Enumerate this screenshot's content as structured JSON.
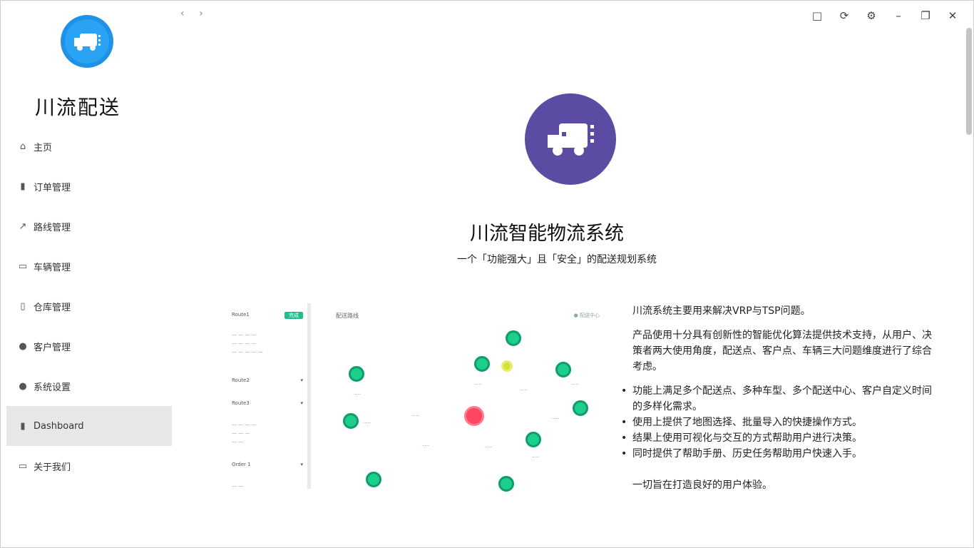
{
  "window": {
    "back": "‹",
    "forward": "›",
    "controls": [
      "□",
      "⟳",
      "⚙",
      "–",
      "❐",
      "✕"
    ]
  },
  "sidebar": {
    "brand": "川流配送",
    "items": [
      {
        "label": "主页",
        "icon": "home-icon",
        "glyph": "⌂"
      },
      {
        "label": "订单管理",
        "icon": "bar-chart-icon",
        "glyph": "▮"
      },
      {
        "label": "路线管理",
        "icon": "route-icon",
        "glyph": "↗"
      },
      {
        "label": "车辆管理",
        "icon": "truck-icon",
        "glyph": "▭"
      },
      {
        "label": "仓库管理",
        "icon": "clipboard-icon",
        "glyph": "▯"
      },
      {
        "label": "客户管理",
        "icon": "info-icon",
        "glyph": "●"
      },
      {
        "label": "系统设置",
        "icon": "settings-icon",
        "glyph": "●"
      },
      {
        "label": "Dashboard",
        "icon": "dashboard-icon",
        "glyph": "▮"
      },
      {
        "label": "关于我们",
        "icon": "about-icon",
        "glyph": "▭"
      }
    ],
    "active_index": 7
  },
  "main": {
    "title": "川流智能物流系统",
    "subtitle": "一个「功能强大」且「安全」的配送规划系统",
    "description": {
      "intro": "川流系统主要用来解决VRP与TSP问题。",
      "para": "产品使用十分具有创新性的智能优化算法提供技术支持，从用户、决策者两大使用角度，配送点、客户点、车辆三大问题维度进行了综合考虑。",
      "bullets": [
        "功能上满足多个配送点、多种车型、多个配送中心、客户自定义时间的多样化需求。",
        "使用上提供了地图选择、批量导入的快捷操作方式。",
        "结果上使用可视化与交互的方式帮助用户进行决策。",
        "同时提供了帮助手册、历史任务帮助用户快速入手。"
      ],
      "closing": "一切旨在打造良好的用户体验。"
    }
  },
  "preview": {
    "left": {
      "r1": "Route1",
      "r1_tag": "完成",
      "r2": "Route2",
      "r3": "Route3",
      "r4": "Order 1"
    },
    "map_title": "配送路线",
    "legend": "● 配送中心"
  },
  "colors": {
    "logo_blue": "#1f92e6",
    "hero_purple": "#5b4ba2",
    "node_green": "#1ccf8a",
    "node_red": "#ff4560"
  }
}
